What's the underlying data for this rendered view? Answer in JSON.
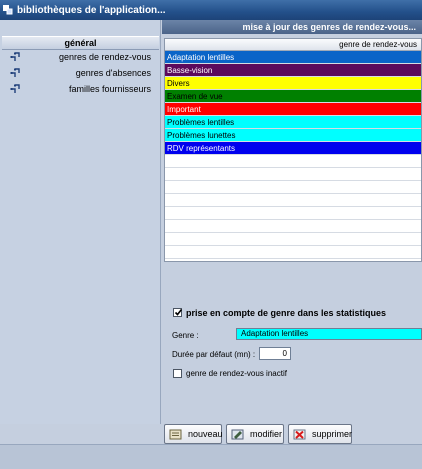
{
  "window": {
    "title": "bibliothèques de l'application..."
  },
  "sidebar": {
    "header": "général",
    "items": [
      {
        "label": "genres de rendez-vous",
        "icon": "link-icon"
      },
      {
        "label": "genres d'absences",
        "icon": "link-icon"
      },
      {
        "label": "familles fournisseurs",
        "icon": "link-icon"
      }
    ]
  },
  "main": {
    "title": "mise à jour des genres de rendez-vous...",
    "list": {
      "column_header": "genre de rendez-vous",
      "rows": [
        {
          "label": "Adaptation lentilles",
          "bg": "#0a64c8",
          "fg": "#ffffff"
        },
        {
          "label": "Basse-vision",
          "bg": "#5c0a5c",
          "fg": "#ffffff"
        },
        {
          "label": "Divers",
          "bg": "#ffff00",
          "fg": "#000000"
        },
        {
          "label": "Examen de vue",
          "bg": "#008000",
          "fg": "#000000"
        },
        {
          "label": "Important",
          "bg": "#ff0000",
          "fg": "#ffffff"
        },
        {
          "label": "Problèmes lentilles",
          "bg": "#00ffff",
          "fg": "#000000"
        },
        {
          "label": "Problèmes lunettes",
          "bg": "#00ffff",
          "fg": "#000000"
        },
        {
          "label": "RDV représentants",
          "bg": "#0000ee",
          "fg": "#ffffff"
        }
      ]
    },
    "form": {
      "stats_label": "prise en compte de genre dans les statistiques",
      "stats_checked": true,
      "genre_label": "Genre :",
      "genre_value": "Adaptation lentilles",
      "genre_color": "#00ffff",
      "duree_label": "Durée par défaut (mn) :",
      "duree_value": "0",
      "inactif_label": "genre de rendez-vous inactif",
      "inactif_checked": false
    },
    "buttons": {
      "new": "nouveau",
      "edit": "modifier",
      "delete": "supprimer"
    }
  }
}
